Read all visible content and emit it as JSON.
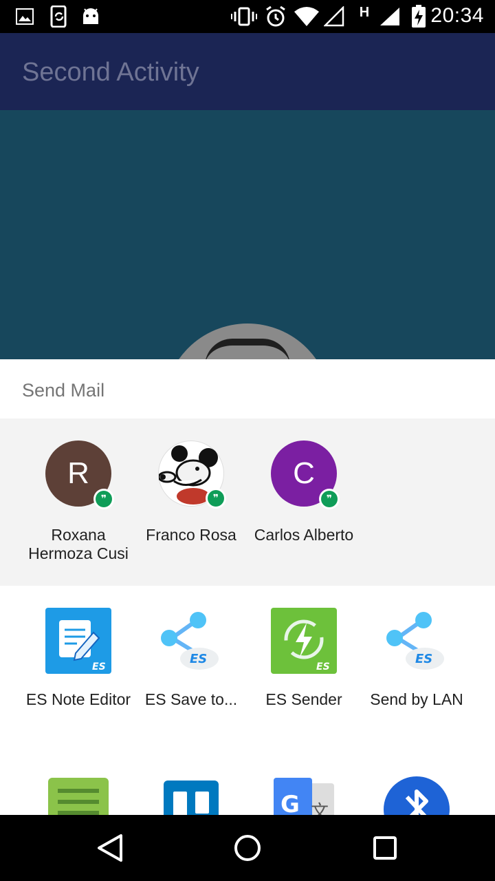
{
  "status_bar": {
    "time": "20:34",
    "network_label": "H",
    "icons": [
      "gallery-icon",
      "sync-icon",
      "android-icon",
      "vibrate-icon",
      "alarm-icon",
      "wifi-icon",
      "signal-icon",
      "signal-icon",
      "battery-charging-icon"
    ]
  },
  "app": {
    "title": "Second Activity",
    "appbar_color": "#1b2554",
    "content_color": "#17475c"
  },
  "share_sheet": {
    "title": "Send Mail",
    "direct_share": [
      {
        "initial": "R",
        "name": "Roxana Hermoza Cusi",
        "color": "#5d4037",
        "badge": "hangouts-icon"
      },
      {
        "initial": "",
        "name": "Franco Rosa",
        "color": "#ffffff",
        "badge": "hangouts-icon",
        "avatar": "cartoon-mouse-avatar"
      },
      {
        "initial": "C",
        "name": "Carlos Alberto",
        "color": "#7b1fa2",
        "badge": "hangouts-icon"
      }
    ],
    "apps": [
      {
        "name": "ES Note Editor",
        "icon": "es-note-editor-icon"
      },
      {
        "name": "ES Save to...",
        "icon": "es-share-icon"
      },
      {
        "name": "ES Sender",
        "icon": "es-sender-icon"
      },
      {
        "name": "Send by LAN",
        "icon": "es-share-icon"
      }
    ],
    "apps_row2": [
      {
        "icon": "notes-app-icon"
      },
      {
        "icon": "trello-icon"
      },
      {
        "icon": "google-translate-icon"
      },
      {
        "icon": "bluetooth-icon"
      }
    ]
  },
  "nav": {
    "back": "back-icon",
    "home": "home-icon",
    "recents": "recents-icon"
  }
}
